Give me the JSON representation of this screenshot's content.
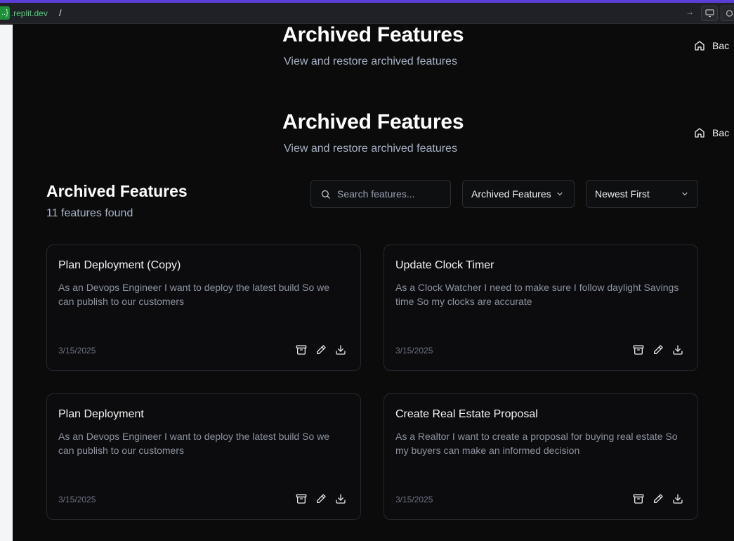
{
  "browser": {
    "domain_prefix": "..}",
    "domain_host": ".replit.dev",
    "path": "/"
  },
  "headers": [
    {
      "title": "Archived Features",
      "subtitle": "View and restore archived features",
      "back_label": "Bac"
    },
    {
      "title": "Archived Features",
      "subtitle": "View and restore archived features",
      "back_label": "Bac"
    }
  ],
  "section": {
    "title": "Archived Features",
    "count": "11 features found"
  },
  "filters": {
    "search_placeholder": "Search features...",
    "view_select": "Archived Features",
    "sort_select": "Newest First"
  },
  "cards": [
    {
      "title": "Plan Deployment (Copy)",
      "description": "As an Devops Engineer I want to deploy the latest build So we can publish to our customers",
      "date": "3/15/2025"
    },
    {
      "title": "Update Clock Timer",
      "description": "As a Clock Watcher I need to make sure I follow daylight Savings time So my clocks are accurate",
      "date": "3/15/2025"
    },
    {
      "title": "Plan Deployment",
      "description": "As an Devops Engineer I want to deploy the latest build So we can publish to our customers",
      "date": "3/15/2025"
    },
    {
      "title": "Create Real Estate Proposal",
      "description": "As a Realtor I want to create a proposal for buying real estate So my buyers can make an informed decision",
      "date": "3/15/2025"
    }
  ],
  "colors": {
    "accent_bar": "#5b3ed6",
    "background": "#0b0b0c",
    "muted_text": "#a6b1c4"
  }
}
